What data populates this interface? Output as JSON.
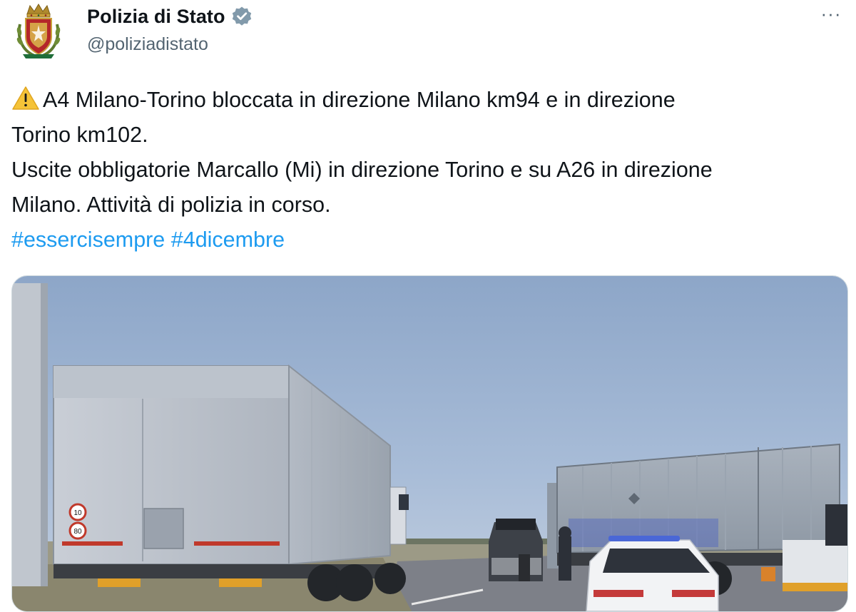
{
  "tweet": {
    "account": {
      "display_name": "Polizia di Stato",
      "handle": "@poliziadistato",
      "verified": true,
      "avatar_icon": "police-crest-icon"
    },
    "more_icon": "more-horizontal-icon",
    "more_label": "···",
    "text": {
      "warning_icon": "warning-icon",
      "line1": "A4 Milano-Torino bloccata in direzione Milano km94 e in direzione",
      "line2": "Torino km102.",
      "line3": "Uscite obbligatorie Marcallo (Mi) in direzione Torino e su A26 in direzione",
      "line4": "Milano. Attività di polizia in corso."
    },
    "hashtags": [
      "#essercisempre",
      "#4dicembre"
    ],
    "media": {
      "type": "photo",
      "rear_sign_plate_1": "10",
      "rear_sign_plate_2": "80"
    },
    "colors": {
      "link": "#1d9bf0",
      "secondary_text": "#536471",
      "primary_text": "#0f1419",
      "verified_badge": "#829aab"
    }
  }
}
